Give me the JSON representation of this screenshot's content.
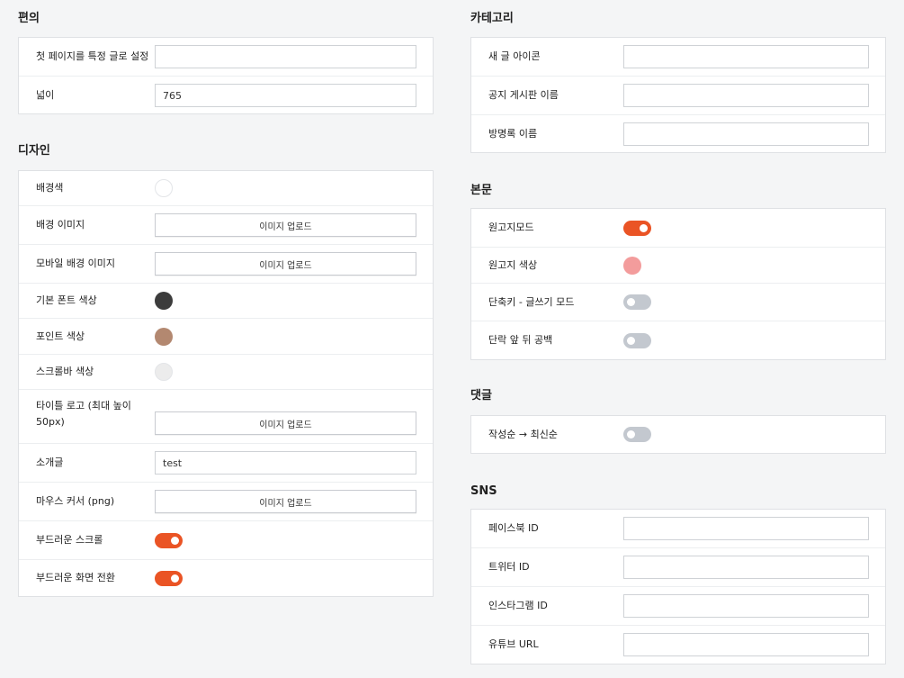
{
  "colors": {
    "accent": "#ea5425",
    "toggle_off": "#c3c8cf"
  },
  "convenience": {
    "title": "편의",
    "rows": [
      {
        "label": "첫 페이지를 특정 글로 설정",
        "value": ""
      },
      {
        "label": "넓이",
        "value": "765"
      }
    ]
  },
  "design": {
    "title": "디자인",
    "upload_label": "이미지 업로드",
    "background_color": {
      "label": "배경색",
      "color": "#ffffff"
    },
    "background_image": {
      "label": "배경 이미지"
    },
    "mobile_background_image": {
      "label": "모바일 배경 이미지"
    },
    "font_color": {
      "label": "기본 폰트 색상",
      "color": "#3c3c3c"
    },
    "point_color": {
      "label": "포인트 색상",
      "color": "#b38870"
    },
    "scrollbar_color": {
      "label": "스크롤바 색상",
      "color": "#ececec"
    },
    "title_logo": {
      "label": "타이틀 로고 (최대 높이 50px)"
    },
    "intro": {
      "label": "소개글",
      "value": "test"
    },
    "mouse_cursor": {
      "label": "마우스 커서 (png)"
    },
    "smooth_scroll": {
      "label": "부드러운 스크롤",
      "on": true
    },
    "smooth_transition": {
      "label": "부드러운 화면 전환",
      "on": true
    }
  },
  "category": {
    "title": "카테고리",
    "rows": [
      {
        "label": "새 글 아이콘",
        "value": ""
      },
      {
        "label": "공지 게시판 이름",
        "value": ""
      },
      {
        "label": "방명록 이름",
        "value": ""
      }
    ]
  },
  "body_section": {
    "title": "본문",
    "manuscript_mode": {
      "label": "원고지모드",
      "on": true
    },
    "manuscript_color": {
      "label": "원고지 색상",
      "color": "#f39c9c"
    },
    "shortcut_write_mode": {
      "label": "단축키 - 글쓰기 모드",
      "on": false
    },
    "paragraph_spacing": {
      "label": "단락 앞 뒤 공백",
      "on": false
    }
  },
  "comments": {
    "title": "댓글",
    "order": {
      "label": "작성순 → 최신순",
      "on": false
    }
  },
  "sns": {
    "title": "SNS",
    "rows": [
      {
        "label": "페이스북 ID",
        "value": ""
      },
      {
        "label": "트위터 ID",
        "value": ""
      },
      {
        "label": "인스타그램 ID",
        "value": ""
      },
      {
        "label": "유튜브 URL",
        "value": ""
      }
    ]
  }
}
